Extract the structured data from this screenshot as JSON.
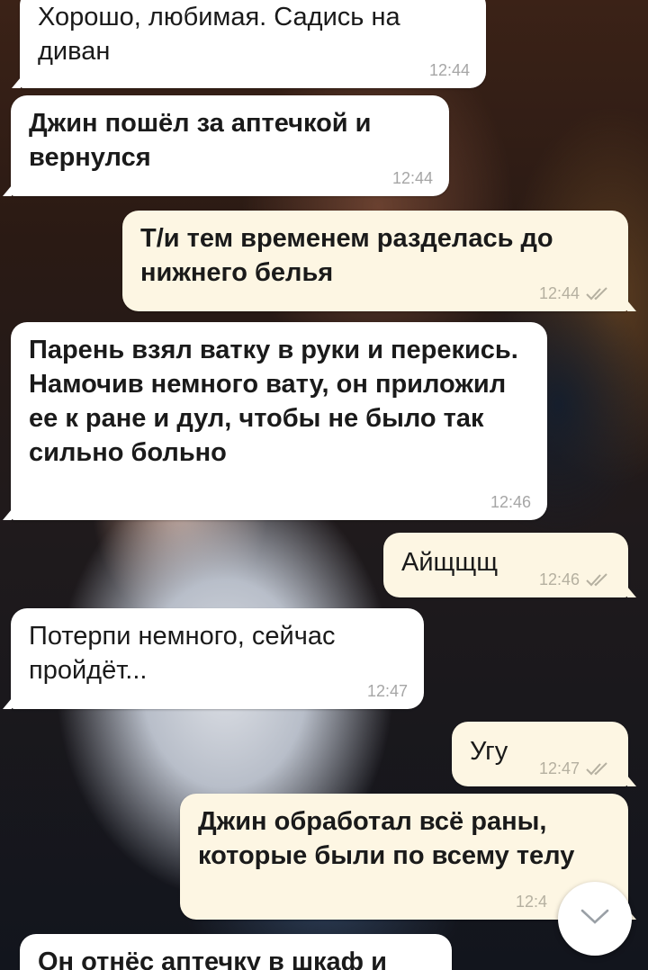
{
  "messages": [
    {
      "text": "Хорошо, любимая. Садись на диван",
      "time": "12:44",
      "dir": "in"
    },
    {
      "text": "Джин пошёл за аптечкой и вернулся",
      "time": "12:44",
      "dir": "in"
    },
    {
      "text": "Т/и тем временем разделась до нижнего белья",
      "time": "12:44",
      "dir": "out"
    },
    {
      "text": "Парень взял ватку в руки и перекись. Намочив немного вату, он приложил ее к ране и дул, чтобы не было так сильно больно",
      "time": "12:46",
      "dir": "in"
    },
    {
      "text": "Айщщщ",
      "time": "12:46",
      "dir": "out"
    },
    {
      "text": "Потерпи немного, сейчас пройдёт...",
      "time": "12:47",
      "dir": "in"
    },
    {
      "text": "Угу",
      "time": "12:47",
      "dir": "out"
    },
    {
      "text": "Джин обработал всё раны, которые были по всему телу",
      "time": "12:4",
      "dir": "out"
    },
    {
      "text": "Он отнёс аптечку в шкаф и",
      "time": "",
      "dir": "in"
    }
  ],
  "icons": {
    "read_receipt": "double-check-icon",
    "scroll_down": "chevron-down-icon"
  },
  "colors": {
    "incoming_bubble": "#ffffff",
    "outgoing_bubble": "#fdf6e3",
    "timestamp": "#a6a6a6",
    "check": "#b5b0a0"
  }
}
